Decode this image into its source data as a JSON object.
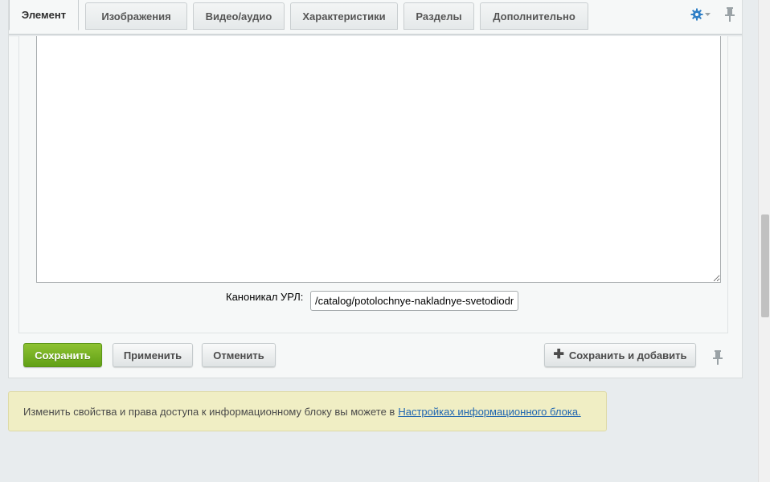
{
  "tabs": [
    {
      "label": "Элемент",
      "active": true
    },
    {
      "label": "Изображения",
      "active": false
    },
    {
      "label": "Видео/аудио",
      "active": false
    },
    {
      "label": "Характеристики",
      "active": false
    },
    {
      "label": "Разделы",
      "active": false
    },
    {
      "label": "Дополнительно",
      "active": false
    }
  ],
  "toolbar_icons": {
    "settings": "gear-icon",
    "pin": "pin-icon"
  },
  "form": {
    "canonical_label": "Каноникал УРЛ:",
    "canonical_value": "/catalog/potolochnye-nakladnye-svetodiodnye/"
  },
  "buttons": {
    "save": "Сохранить",
    "apply": "Применить",
    "cancel": "Отменить",
    "save_add": "Сохранить и добавить"
  },
  "notice": {
    "text": "Изменить свойства и права доступа к информационному блоку вы можете в",
    "link": "Настройках информационного блока."
  },
  "colors": {
    "accent_green": "#6fae1e",
    "link_blue": "#2066b0",
    "notice_bg": "#f0eec4",
    "gear_blue": "#2f7fc6"
  }
}
